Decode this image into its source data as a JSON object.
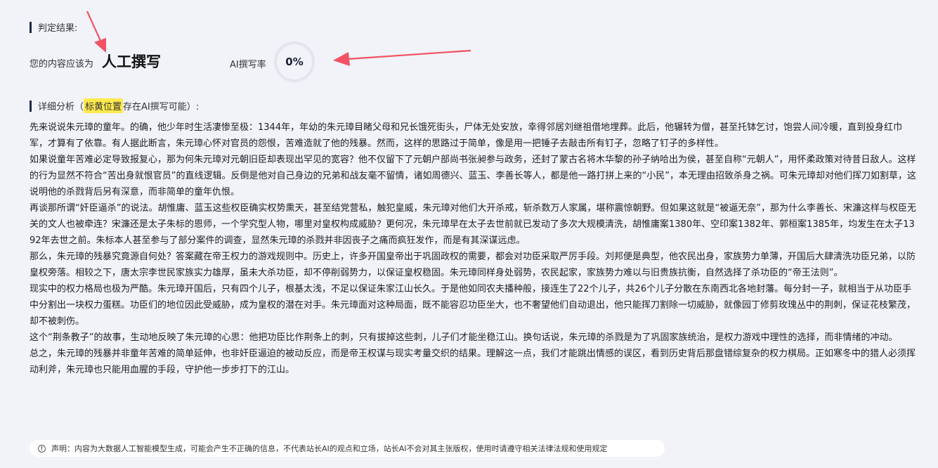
{
  "result": {
    "heading": "判定结果:",
    "verdict_prefix": "您的内容应该为",
    "verdict_value": "人工撰写",
    "ai_rate_label": "AI撰写率",
    "ai_rate_value": "0%",
    "ai_rate_fraction": 0
  },
  "analysis": {
    "heading_before": "详细分析（",
    "heading_highlight": "标黄位置",
    "heading_after": "存在AI撰写可能）:"
  },
  "article": {
    "paragraphs": [
      "先来说说朱元璋的童年。的确，他少年时生活凄惨至极：1344年，年幼的朱元璋目睹父母和兄长饿死街头，尸体无处安放，幸得邻居刘继祖借地埋葬。此后，他辗转为僧，甚至托钵乞讨，饱尝人间冷暖，直到投身红巾军，才算有了依靠。有人据此断言，朱元璋心怀对官员的怨恨，苦难造就了他的残暴。然而，这样的思路过于简单，像是用一把锤子去敲击所有钉子，忽略了钉子的多样性。",
      "如果说童年苦难必定导致报复心，那为何朱元璋对元朝旧臣却表现出罕见的宽容？他不仅留下了元朝户部尚书张昶参与政务，还封了蒙古名将木华黎的孙子纳哈出为侯，甚至自称“元朝人”，用怀柔政策对待昔日敌人。这样的行为显然不符合“苦出身就恨官员”的直线逻辑。反倒是他对自己身边的兄弟和战友毫不留情，诸如周德兴、蓝玉、李善长等人，都是他一路打拼上来的“小民”，本无理由招致杀身之祸。可朱元璋却对他们挥刀如割草，这说明他的杀戮背后另有深意，而非简单的童年仇恨。",
      "再谈那所谓“奸臣逼杀”的说法。胡惟庸、蓝玉这些权臣确实权势熏天，甚至结党营私，触犯皇威，朱元璋对他们大开杀戒，斩杀数万人家属，堪称震惊朝野。但如果这就是“被逼无奈”，那为什么李善长、宋濂这样与权臣无关的文人也被牵连？宋濂还是太子朱标的恩师，一个学究型人物，哪里对皇权构成威胁？更何况，朱元璋早在太子去世前就已发动了多次大规模清洗，胡惟庸案1380年、空印案1382年、郭桓案1385年，均发生在太子1392年去世之前。朱标本人甚至参与了部分案件的调查，显然朱元璋的杀戮并非因丧子之痛而疯狂发作，而是有其深谋远虑。",
      "那么，朱元璋的残暴究竟源自何处？答案藏在帝王权力的游戏规则中。历史上，许多开国皇帝出于巩固政权的需要，都会对功臣采取严厉手段。刘邦便是典型，他农民出身，家族势力单薄，开国后大肆清洗功臣兄弟，以防皇权旁落。相较之下，唐太宗李世民家族实力雄厚，虽未大杀功臣，却不停削弱势力，以保证皇权稳固。朱元璋同样身处弱势，农民起家，家族势力难以与旧贵族抗衡，自然选择了杀功臣的“帝王法则”。",
      "现实中的权力格局也极为严酷。朱元璋开国后，只有四个儿子，根基太浅，不足以保证朱家江山长久。于是他如同农夫播种般，接连生了22个儿子，共26个儿子分散在东南西北各地封藩。每分封一子，就相当于从功臣手中分割出一块权力蛋糕。功臣们的地位因此受威胁，成为皇权的潜在对手。朱元璋面对这种局面，既不能容忍功臣坐大，也不奢望他们自动退出，他只能挥刀割除一切威胁，就像园丁修剪玫瑰丛中的荆刺，保证花枝繁茂，却不被刺伤。",
      "这个“荆条教子”的故事，生动地反映了朱元璋的心思：他把功臣比作荆条上的刺，只有拔掉这些刺，儿子们才能坐稳江山。换句话说，朱元璋的杀戮是为了巩固家族统治，是权力游戏中理性的选择，而非情绪的冲动。",
      "总之，朱元璋的残暴并非童年苦难的简单延伸，也非奸臣逼迫的被动反应，而是帝王权谋与现实考量交织的结果。理解这一点，我们才能跳出情感的误区，看到历史背后那盘错综复杂的权力棋局。正如寒冬中的猎人必须挥动利斧，朱元璋也只能用血腥的手段，守护他一步步打下的江山。"
    ]
  },
  "disclaimer": {
    "icon": "info-circle-icon",
    "text": "声明：内容为大数据人工智能模型生成，可能会产生不正确的信息，不代表站长AI的观点和立场，站长AI不会对其主张版权，使用时请遵守相关法律法规和使用规定"
  },
  "colors": {
    "background": "#f1f3f9",
    "highlight": "#ffe94d",
    "arrow": "#f25262",
    "gauge_ring": "#e3e5ee"
  }
}
